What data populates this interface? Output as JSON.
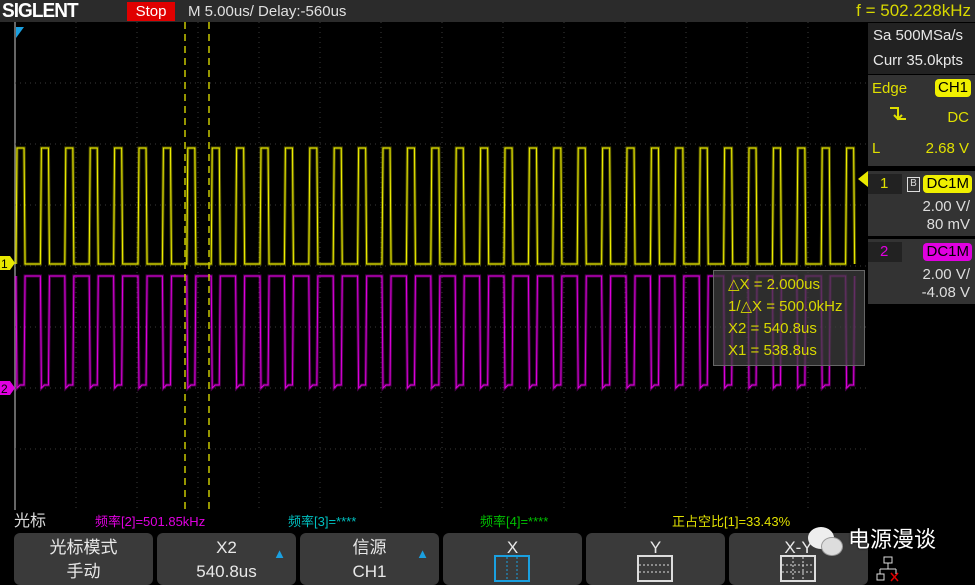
{
  "header": {
    "logo": "SIGLENT",
    "run_state": "Stop",
    "timebase": "M 5.00us/  Delay:-560us",
    "frequency": "f = 502.228kHz"
  },
  "acquisition": {
    "sample_rate": "Sa 500MSa/s",
    "memory": "Curr 35.0kpts"
  },
  "trigger": {
    "type": "Edge",
    "source": "CH1",
    "coupling": "DC",
    "level_label": "L",
    "level": "2.68 V",
    "slope_icon": "falling-edge-icon"
  },
  "channels": [
    {
      "number": "1",
      "coupling": "DC1M",
      "scale": "2.00 V/",
      "offset": "80 mV",
      "color": "#f0f000"
    },
    {
      "number": "2",
      "coupling": "DC1M",
      "scale": "2.00 V/",
      "offset": "-4.08 V",
      "color": "#e000e0"
    }
  ],
  "cursor_readout": {
    "delta_x": "△X = 2.000us",
    "inv_delta_x": "1/△X = 500.0kHz",
    "x2": "X2 = 540.8us",
    "x1": "X1 = 538.8us"
  },
  "measurements": {
    "label": "光标",
    "freq2": "频率[2]=501.85kHz",
    "freq3": "频率[3]=****",
    "freq4": "频率[4]=****",
    "duty1": "正占空比[1]=33.43%"
  },
  "softkeys": [
    {
      "line1": "光标模式",
      "line2": "手动"
    },
    {
      "line1": "X2",
      "line2": "540.8us"
    },
    {
      "line1": "信源",
      "line2": "CH1"
    },
    {
      "line1": "X"
    },
    {
      "line1": "Y"
    },
    {
      "line1": "X-Y"
    }
  ],
  "watermark": "电源漫谈",
  "colors": {
    "ch1": "#f0f000",
    "ch2": "#e000e0",
    "accent": "#1aa0e0"
  }
}
